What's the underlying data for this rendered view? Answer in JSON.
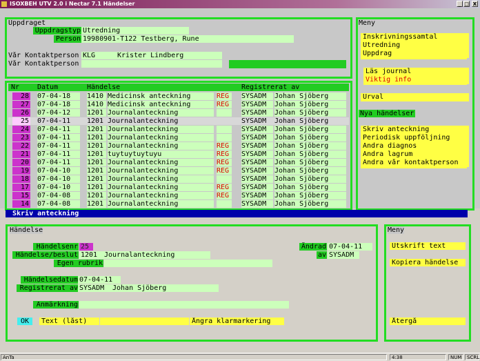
{
  "window": {
    "title": "ISOXBEH UTV 2.0 i Nectar 7.1   Händelser",
    "buttons": [
      "_",
      "□",
      "X"
    ]
  },
  "uppdrag": {
    "heading": "Uppdraget",
    "uppdragstyp_label": "Uppdragstyp",
    "uppdragstyp_value": "Utredning",
    "person_label": "Person",
    "person_id": "19980901-T122",
    "person_name": "Testberg, Rune",
    "kontakt1_label": "Vår Kontaktperson",
    "kontakt1_code": "KLG",
    "kontakt1_name": "Krister Lindberg",
    "kontakt2_label": "Vår Kontaktperson"
  },
  "table": {
    "headers": {
      "nr": "Nr",
      "datum": "Datum",
      "handelse": "Händelse",
      "registrerat": "Registrerat av"
    },
    "rows": [
      {
        "nr": "28",
        "datum": "07-04-18",
        "code": "1410",
        "text": "Medicinsk anteckning",
        "reg": "REG",
        "user": "SYSADM",
        "name": "Johan Sjöberg"
      },
      {
        "nr": "27",
        "datum": "07-04-18",
        "code": "1410",
        "text": "Medicinsk anteckning",
        "reg": "REG",
        "user": "SYSADM",
        "name": "Johan Sjöberg"
      },
      {
        "nr": "26",
        "datum": "07-04-12",
        "code": "1201",
        "text": "Journalanteckning",
        "reg": "",
        "user": "SYSADM",
        "name": "Johan Sjöberg"
      },
      {
        "nr": "25",
        "datum": "07-04-11",
        "code": "1201",
        "text": "Journalanteckning",
        "reg": "",
        "user": "SYSADM",
        "name": "Johan Sjöberg",
        "selected": true
      },
      {
        "nr": "24",
        "datum": "07-04-11",
        "code": "1201",
        "text": "Journalanteckning",
        "reg": "",
        "user": "SYSADM",
        "name": "Johan Sjöberg"
      },
      {
        "nr": "23",
        "datum": "07-04-11",
        "code": "1201",
        "text": "Journalanteckning",
        "reg": "",
        "user": "SYSADM",
        "name": "Johan Sjöberg"
      },
      {
        "nr": "22",
        "datum": "07-04-11",
        "code": "1201",
        "text": "Journalanteckning",
        "reg": "REG",
        "user": "SYSADM",
        "name": "Johan Sjöberg"
      },
      {
        "nr": "21",
        "datum": "07-04-11",
        "code": "1201",
        "text": "tuytuytuytuyu",
        "reg": "REG",
        "user": "SYSADM",
        "name": "Johan Sjöberg"
      },
      {
        "nr": "20",
        "datum": "07-04-11",
        "code": "1201",
        "text": "Journalanteckning",
        "reg": "REG",
        "user": "SYSADM",
        "name": "Johan Sjöberg"
      },
      {
        "nr": "19",
        "datum": "07-04-10",
        "code": "1201",
        "text": "Journalanteckning",
        "reg": "REG",
        "user": "SYSADM",
        "name": "Johan Sjöberg"
      },
      {
        "nr": "18",
        "datum": "07-04-10",
        "code": "1201",
        "text": "Journalanteckning",
        "reg": "",
        "user": "SYSADM",
        "name": "Johan Sjöberg"
      },
      {
        "nr": "17",
        "datum": "07-04-10",
        "code": "1201",
        "text": "Journalanteckning",
        "reg": "REG",
        "user": "SYSADM",
        "name": "Johan Sjöberg"
      },
      {
        "nr": "15",
        "datum": "07-04-08",
        "code": "1201",
        "text": "Journalanteckning",
        "reg": "REG",
        "user": "SYSADM",
        "name": "Johan Sjöberg"
      },
      {
        "nr": "14",
        "datum": "07-04-08",
        "code": "1201",
        "text": "Journalanteckning",
        "reg": "",
        "user": "SYSADM",
        "name": "Johan Sjöberg"
      }
    ]
  },
  "meny_top": {
    "heading": "Meny",
    "group1": [
      "Inskrivningssamtal",
      "Utredning",
      "Uppdrag"
    ],
    "group2": [
      "Läs journal"
    ],
    "group2_red": "Viktig info",
    "urval": "Urval",
    "nya_handelser": "Nya händelser",
    "group3": [
      "Skriv anteckning",
      "Periodisk uppföljning",
      "Ändra diagnos",
      "Ändra lagrum",
      "Ändra vår kontaktperson"
    ]
  },
  "blue_bar": "Skriv anteckning",
  "detail": {
    "heading": "Händelse",
    "handelsenr_label": "Händelsenr",
    "handelsenr_value": "25",
    "andrad_label": "Ändrad",
    "andrad_value": "07-04-11",
    "beslut_label": "Händelse/beslut",
    "beslut_code": "1201",
    "beslut_text": "Journalanteckning",
    "av_label": "av",
    "av_value": "SYSADM",
    "rubrik_label": "Egen rubrik",
    "datum_label": "Händelsedatum",
    "datum_value": "07-04-11",
    "reg_label": "Registrerat av",
    "reg_user": "SYSADM",
    "reg_name": "Johan Sjöberg",
    "anm_label": "Anmärkning",
    "ok": "OK",
    "text_last": "Text (låst)",
    "angra": "Ångra klarmarkering"
  },
  "meny_bottom": {
    "heading": "Meny",
    "items": [
      "Utskrift text",
      "Kopiera händelse"
    ],
    "atergå": "Återgå"
  },
  "statusbar": {
    "left": "AnTa",
    "time": "4:38",
    "num": "NUM",
    "scrl": "SCRL"
  }
}
